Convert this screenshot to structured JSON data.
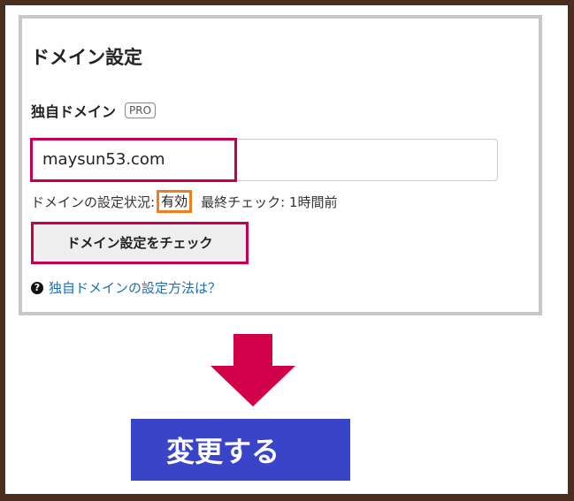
{
  "panel": {
    "title": "ドメイン設定",
    "label": "独自ドメイン",
    "badge": "PRO",
    "domain_value": "maysun53.com",
    "status_label": "ドメインの設定状況:",
    "status_value": "有効",
    "last_check": "最終チェック: 1時間前",
    "check_button": "ドメイン設定をチェック",
    "help_link": "独自ドメインの設定方法は？"
  },
  "annotation": {
    "change_label": "変更する"
  },
  "colors": {
    "highlight": "#c4004f",
    "status_highlight": "#f07d20",
    "arrow": "#d10048",
    "change_button": "#3a44c8",
    "link": "#1a6fb5"
  }
}
